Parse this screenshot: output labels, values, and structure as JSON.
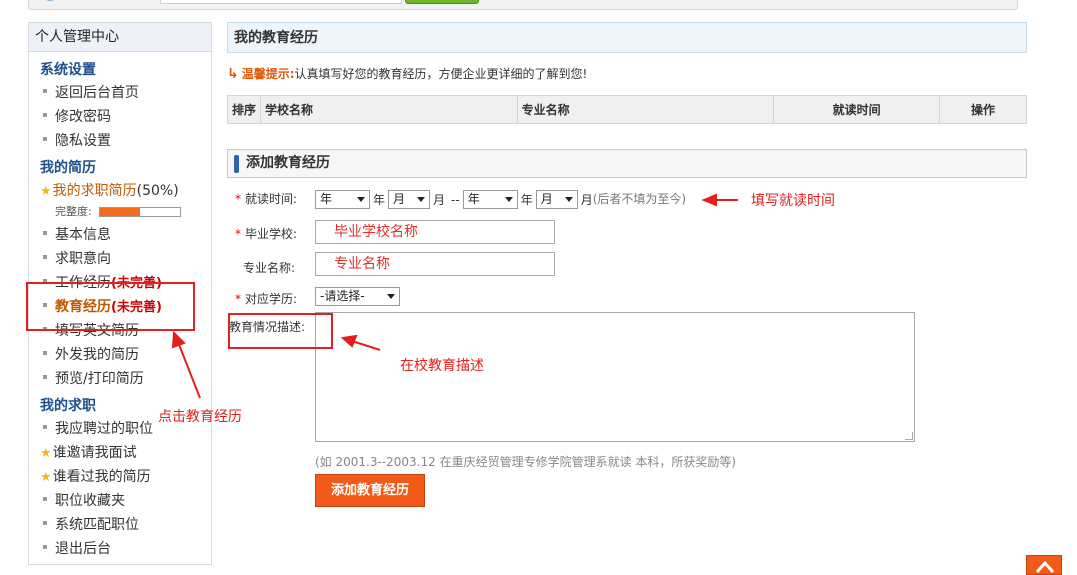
{
  "sidebar": {
    "title": "个人管理中心",
    "groups": [
      {
        "label": "系统设置"
      },
      {
        "label": "我的简历"
      },
      {
        "label": "我的求职"
      }
    ],
    "settings_items": [
      "返回后台首页",
      "修改密码",
      "隐私设置"
    ],
    "resume": {
      "primary": "我的求职简历",
      "percent": "(50%)",
      "progress_label": "完整度:",
      "progress_value": 0.5,
      "items": [
        "基本信息",
        "求职意向"
      ],
      "work": "工作经历",
      "work_status": "(未完善)",
      "edu": "教育经历",
      "edu_status": "(未完善)",
      "english": "填写英文简历",
      "send": "外发我的简历",
      "preview": "预览/打印简历"
    },
    "job_items": [
      "我应聘过的职位",
      "谁邀请我面试",
      "谁看过我的简历",
      "职位收藏夹",
      "系统匹配职位",
      "退出后台"
    ]
  },
  "main": {
    "panel_title": "我的教育经历",
    "tip_label": "温馨提示:",
    "tip_text": "认真填写好您的教育经历，方便企业更详细的了解到您!",
    "table_headers": [
      "排序",
      "学校名称",
      "专业名称",
      "就读时间",
      "操作"
    ],
    "add_title": "添加教育经历",
    "form": {
      "period_label": "就读时间:",
      "year": "年",
      "month": "月",
      "dash": "--",
      "period_hint": "(后者不填为至今)",
      "school_label": "毕业学校:",
      "school_value": "毕业学校名称",
      "major_label": "专业名称:",
      "major_value": "专业名称",
      "degree_label": "对应学历:",
      "degree_value": "-请选择-",
      "desc_label": "教育情况描述:",
      "example": "(如 2001.3--2003.12 在重庆经贸管理专修学院管理系就读 本科，所获奖励等)",
      "submit": "添加教育经历"
    }
  },
  "annotations": {
    "period": "填写就读时间",
    "desc": "在校教育描述",
    "click_edu": "点击教育经历"
  },
  "colors": {
    "accent": "#f15a18",
    "annotation": "#e2201d",
    "link_blue": "#1f4f8c"
  }
}
